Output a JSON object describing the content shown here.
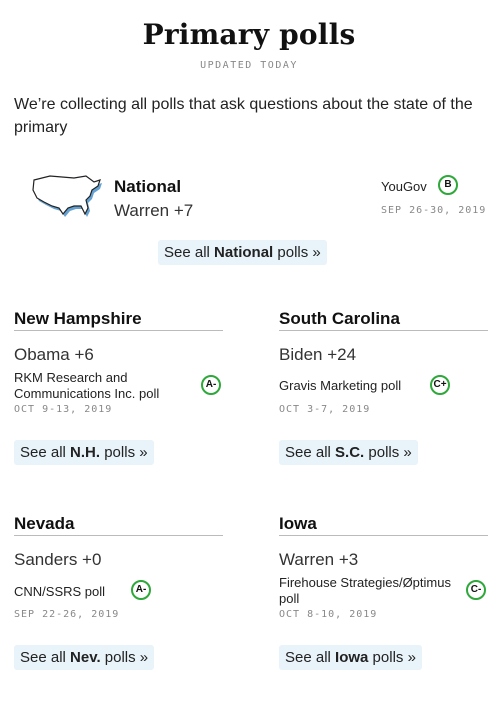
{
  "header": {
    "title": "Primary polls",
    "updated": "UPDATED TODAY"
  },
  "intro": "We’re collecting all polls that ask questions about the state of the primary",
  "national": {
    "name": "National",
    "result": "Warren +7",
    "pollster": "YouGov",
    "grade": "B",
    "date": "SEP 26-30, 2019",
    "see_all_prefix": "See all ",
    "see_all_bold": "National",
    "see_all_suffix": " polls »"
  },
  "states": [
    {
      "name": "New Hampshire",
      "result": "Obama +6",
      "pollster": "RKM Research and Communications Inc. poll",
      "grade": "A-",
      "date": "OCT 9-13, 2019",
      "see_all_prefix": "See all ",
      "see_all_bold": "N.H.",
      "see_all_suffix": " polls »"
    },
    {
      "name": "South Carolina",
      "result": "Biden +24",
      "pollster": "Gravis Marketing poll",
      "grade": "C+",
      "date": "OCT 3-7, 2019",
      "see_all_prefix": "See all ",
      "see_all_bold": "S.C.",
      "see_all_suffix": " polls »"
    },
    {
      "name": "Nevada",
      "result": "Sanders +0",
      "pollster": "CNN/SSRS poll",
      "grade": "A-",
      "date": "SEP 22-26, 2019",
      "see_all_prefix": "See all ",
      "see_all_bold": "Nev.",
      "see_all_suffix": " polls »"
    },
    {
      "name": "Iowa",
      "result": "Warren +3",
      "pollster": "Firehouse Strategies/Øptimus poll",
      "grade": "C-",
      "date": "OCT 8-10, 2019",
      "see_all_prefix": "See all ",
      "see_all_bold": "Iowa",
      "see_all_suffix": " polls »"
    }
  ],
  "colors": {
    "grade_ring": "#2ea83a",
    "link_bg": "#e9f3fa",
    "map_fill": "#ffffff",
    "map_shadow": "#4a90c8"
  }
}
